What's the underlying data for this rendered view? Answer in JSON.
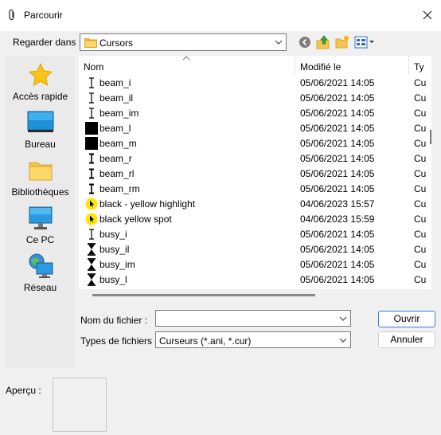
{
  "window": {
    "title": "Parcourir"
  },
  "lookin": {
    "label": "Regarder dans :",
    "value": "Cursors"
  },
  "places": [
    {
      "label": "Accès rapide",
      "icon": "star-icon"
    },
    {
      "label": "Bureau",
      "icon": "desktop-icon"
    },
    {
      "label": "Bibliothèques",
      "icon": "libraries-icon"
    },
    {
      "label": "Ce PC",
      "icon": "computer-icon"
    },
    {
      "label": "Réseau",
      "icon": "network-icon"
    }
  ],
  "columns": {
    "name": "Nom",
    "modified": "Modifié le",
    "type": "Ty"
  },
  "files": [
    {
      "name": "beam_i",
      "date": "05/06/2021 14:05",
      "type": "Cu",
      "icon": "beam-thin"
    },
    {
      "name": "beam_il",
      "date": "05/06/2021 14:05",
      "type": "Cu",
      "icon": "beam-thin"
    },
    {
      "name": "beam_im",
      "date": "05/06/2021 14:05",
      "type": "Cu",
      "icon": "beam-thin"
    },
    {
      "name": "beam_l",
      "date": "05/06/2021 14:05",
      "type": "Cu",
      "icon": "black-block"
    },
    {
      "name": "beam_m",
      "date": "05/06/2021 14:05",
      "type": "Cu",
      "icon": "black-block"
    },
    {
      "name": "beam_r",
      "date": "05/06/2021 14:05",
      "type": "Cu",
      "icon": "beam-thick"
    },
    {
      "name": "beam_rl",
      "date": "05/06/2021 14:05",
      "type": "Cu",
      "icon": "beam-thick"
    },
    {
      "name": "beam_rm",
      "date": "05/06/2021 14:05",
      "type": "Cu",
      "icon": "beam-thick"
    },
    {
      "name": "black - yellow highlight",
      "date": "04/06/2023 15:57",
      "type": "Cu",
      "icon": "yellow-spot"
    },
    {
      "name": "black yellow spot",
      "date": "04/06/2023 15:59",
      "type": "Cu",
      "icon": "yellow-spot"
    },
    {
      "name": "busy_i",
      "date": "05/06/2021 14:05",
      "type": "Cu",
      "icon": "beam-thin"
    },
    {
      "name": "busy_il",
      "date": "05/06/2021 14:05",
      "type": "Cu",
      "icon": "hourglass"
    },
    {
      "name": "busy_im",
      "date": "05/06/2021 14:05",
      "type": "Cu",
      "icon": "hourglass"
    },
    {
      "name": "busy_l",
      "date": "05/06/2021 14:05",
      "type": "Cu",
      "icon": "hourglass"
    }
  ],
  "filename": {
    "label": "Nom du fichier :",
    "value": ""
  },
  "filetype": {
    "label": "Types de fichiers :",
    "value": "Curseurs (*.ani, *.cur)"
  },
  "buttons": {
    "open": "Ouvrir",
    "cancel": "Annuler"
  },
  "preview": {
    "label": "Aperçu :"
  }
}
